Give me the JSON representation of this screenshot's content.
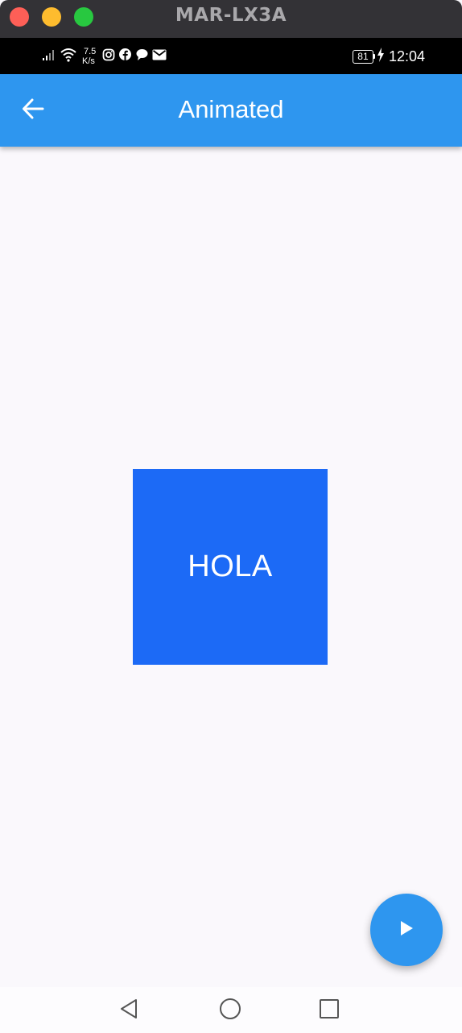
{
  "window": {
    "title": "MAR-LX3A"
  },
  "status_bar": {
    "net_speed_value": "7.5",
    "net_speed_unit": "K/s",
    "battery_level": "81",
    "time": "12:04",
    "icons": [
      "signal-icon",
      "wifi-icon",
      "instagram-icon",
      "facebook-icon",
      "chat-icon",
      "mail-icon",
      "battery-icon",
      "charging-icon"
    ]
  },
  "app_bar": {
    "title": "Animated",
    "back_icon": "arrow-back-icon"
  },
  "content": {
    "box_text": "HOLA",
    "box_color": "#1c6af6"
  },
  "fab": {
    "icon": "play-icon",
    "color": "#2e96ef"
  },
  "nav_bar": {
    "buttons": [
      "back-triangle-icon",
      "home-circle-icon",
      "recents-square-icon"
    ]
  },
  "colors": {
    "primary": "#2e96ef",
    "background": "#faf8fc",
    "window_titlebar": "#333236"
  }
}
